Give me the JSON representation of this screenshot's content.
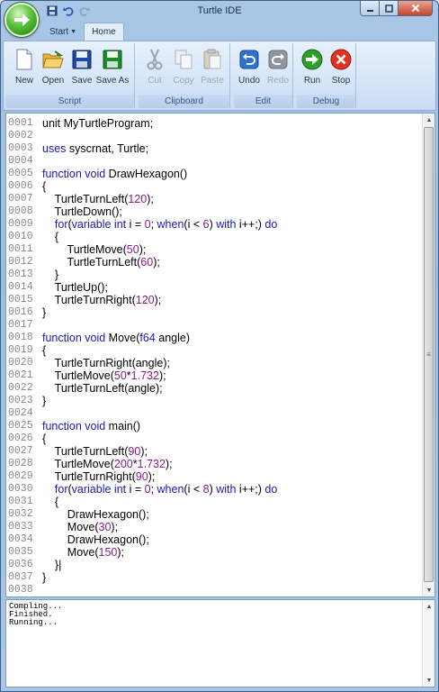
{
  "window": {
    "title": "Turtle IDE"
  },
  "tabs": [
    {
      "label": "Start",
      "active": false
    },
    {
      "label": "Home",
      "active": true
    }
  ],
  "ribbon": {
    "groups": [
      {
        "label": "Script",
        "buttons": [
          {
            "label": "New",
            "icon": "new-document-icon",
            "enabled": true
          },
          {
            "label": "Open",
            "icon": "open-folder-icon",
            "enabled": true
          },
          {
            "label": "Save",
            "icon": "save-disk-icon",
            "enabled": true
          },
          {
            "label": "Save As",
            "icon": "save-as-disk-icon",
            "enabled": true
          }
        ]
      },
      {
        "label": "Clipboard",
        "buttons": [
          {
            "label": "Cut",
            "icon": "scissors-icon",
            "enabled": false
          },
          {
            "label": "Copy",
            "icon": "copy-icon",
            "enabled": false
          },
          {
            "label": "Paste",
            "icon": "paste-icon",
            "enabled": false
          }
        ]
      },
      {
        "label": "Edit",
        "buttons": [
          {
            "label": "Undo",
            "icon": "undo-icon",
            "enabled": true
          },
          {
            "label": "Redo",
            "icon": "redo-icon",
            "enabled": false
          }
        ]
      },
      {
        "label": "Debug",
        "buttons": [
          {
            "label": "Run",
            "icon": "run-arrow-icon",
            "enabled": true
          },
          {
            "label": "Stop",
            "icon": "stop-x-icon",
            "enabled": true
          }
        ]
      }
    ]
  },
  "colors": {
    "keyword": "#1a1ab4",
    "number": "#8b1a8b",
    "ribbon": "#d7e6f8",
    "chrome": "#9bbde2"
  },
  "editor": {
    "lines": [
      [
        [
          "n",
          "0001"
        ],
        [
          "t",
          "unit MyTurtleProgram;"
        ]
      ],
      [
        [
          "n",
          "0002"
        ]
      ],
      [
        [
          "n",
          "0003"
        ],
        [
          "k",
          "uses"
        ],
        [
          "t",
          " syscrnat, Turtle;"
        ]
      ],
      [
        [
          "n",
          "0004"
        ]
      ],
      [
        [
          "n",
          "0005"
        ],
        [
          "k",
          "function void"
        ],
        [
          "t",
          " DrawHexagon()"
        ]
      ],
      [
        [
          "n",
          "0006"
        ],
        [
          "t",
          "{"
        ]
      ],
      [
        [
          "n",
          "0007"
        ],
        [
          "t",
          "    TurtleTurnLeft("
        ],
        [
          "m",
          "120"
        ],
        [
          "t",
          ");"
        ]
      ],
      [
        [
          "n",
          "0008"
        ],
        [
          "t",
          "    TurtleDown();"
        ]
      ],
      [
        [
          "n",
          "0009"
        ],
        [
          "t",
          "    "
        ],
        [
          "k",
          "for"
        ],
        [
          "t",
          "("
        ],
        [
          "k",
          "variable int"
        ],
        [
          "t",
          " i = "
        ],
        [
          "m",
          "0"
        ],
        [
          "t",
          "; "
        ],
        [
          "k",
          "when"
        ],
        [
          "t",
          "(i < "
        ],
        [
          "m",
          "6"
        ],
        [
          "t",
          ") "
        ],
        [
          "k",
          "with"
        ],
        [
          "t",
          " i++;) "
        ],
        [
          "k",
          "do"
        ]
      ],
      [
        [
          "n",
          "0010"
        ],
        [
          "t",
          "    {"
        ]
      ],
      [
        [
          "n",
          "0011"
        ],
        [
          "t",
          "        TurtleMove("
        ],
        [
          "m",
          "50"
        ],
        [
          "t",
          ");"
        ]
      ],
      [
        [
          "n",
          "0012"
        ],
        [
          "t",
          "        TurtleTurnLeft("
        ],
        [
          "m",
          "60"
        ],
        [
          "t",
          ");"
        ]
      ],
      [
        [
          "n",
          "0013"
        ],
        [
          "t",
          "    }"
        ]
      ],
      [
        [
          "n",
          "0014"
        ],
        [
          "t",
          "    TurtleUp();"
        ]
      ],
      [
        [
          "n",
          "0015"
        ],
        [
          "t",
          "    TurtleTurnRight("
        ],
        [
          "m",
          "120"
        ],
        [
          "t",
          ");"
        ]
      ],
      [
        [
          "n",
          "0016"
        ],
        [
          "t",
          "}"
        ]
      ],
      [
        [
          "n",
          "0017"
        ]
      ],
      [
        [
          "n",
          "0018"
        ],
        [
          "k",
          "function void"
        ],
        [
          "t",
          " Move("
        ],
        [
          "k",
          "f64"
        ],
        [
          "t",
          " angle)"
        ]
      ],
      [
        [
          "n",
          "0019"
        ],
        [
          "t",
          "{"
        ]
      ],
      [
        [
          "n",
          "0020"
        ],
        [
          "t",
          "    TurtleTurnRight(angle);"
        ]
      ],
      [
        [
          "n",
          "0021"
        ],
        [
          "t",
          "    TurtleMove("
        ],
        [
          "m",
          "50"
        ],
        [
          "t",
          "*"
        ],
        [
          "m",
          "1.732"
        ],
        [
          "t",
          ");"
        ]
      ],
      [
        [
          "n",
          "0022"
        ],
        [
          "t",
          "    TurtleTurnLeft(angle);"
        ]
      ],
      [
        [
          "n",
          "0023"
        ],
        [
          "t",
          "}"
        ]
      ],
      [
        [
          "n",
          "0024"
        ]
      ],
      [
        [
          "n",
          "0025"
        ],
        [
          "k",
          "function void"
        ],
        [
          "t",
          " main()"
        ]
      ],
      [
        [
          "n",
          "0026"
        ],
        [
          "t",
          "{"
        ]
      ],
      [
        [
          "n",
          "0027"
        ],
        [
          "t",
          "    TurtleTurnLeft("
        ],
        [
          "m",
          "90"
        ],
        [
          "t",
          ");"
        ]
      ],
      [
        [
          "n",
          "0028"
        ],
        [
          "t",
          "    TurtleMove("
        ],
        [
          "m",
          "200"
        ],
        [
          "t",
          "*"
        ],
        [
          "m",
          "1.732"
        ],
        [
          "t",
          ");"
        ]
      ],
      [
        [
          "n",
          "0029"
        ],
        [
          "t",
          "    TurtleTurnRight("
        ],
        [
          "m",
          "90"
        ],
        [
          "t",
          ");"
        ]
      ],
      [
        [
          "n",
          "0030"
        ],
        [
          "t",
          "    "
        ],
        [
          "k",
          "for"
        ],
        [
          "t",
          "("
        ],
        [
          "k",
          "variable int"
        ],
        [
          "t",
          " i = "
        ],
        [
          "m",
          "0"
        ],
        [
          "t",
          "; "
        ],
        [
          "k",
          "when"
        ],
        [
          "t",
          "(i < "
        ],
        [
          "m",
          "8"
        ],
        [
          "t",
          ") "
        ],
        [
          "k",
          "with"
        ],
        [
          "t",
          " i++;) "
        ],
        [
          "k",
          "do"
        ]
      ],
      [
        [
          "n",
          "0031"
        ],
        [
          "t",
          "    {"
        ]
      ],
      [
        [
          "n",
          "0032"
        ],
        [
          "t",
          "        DrawHexagon();"
        ]
      ],
      [
        [
          "n",
          "0033"
        ],
        [
          "t",
          "        Move("
        ],
        [
          "m",
          "30"
        ],
        [
          "t",
          ");"
        ]
      ],
      [
        [
          "n",
          "0034"
        ],
        [
          "t",
          "        DrawHexagon();"
        ]
      ],
      [
        [
          "n",
          "0035"
        ],
        [
          "t",
          "        Move("
        ],
        [
          "m",
          "150"
        ],
        [
          "t",
          ");"
        ]
      ],
      [
        [
          "n",
          "0036"
        ],
        [
          "t",
          "    }|"
        ]
      ],
      [
        [
          "n",
          "0037"
        ],
        [
          "t",
          "}"
        ]
      ],
      [
        [
          "n",
          "0038"
        ]
      ]
    ]
  },
  "output": {
    "lines": [
      "Compling...",
      "Finished.",
      "Running..."
    ]
  }
}
